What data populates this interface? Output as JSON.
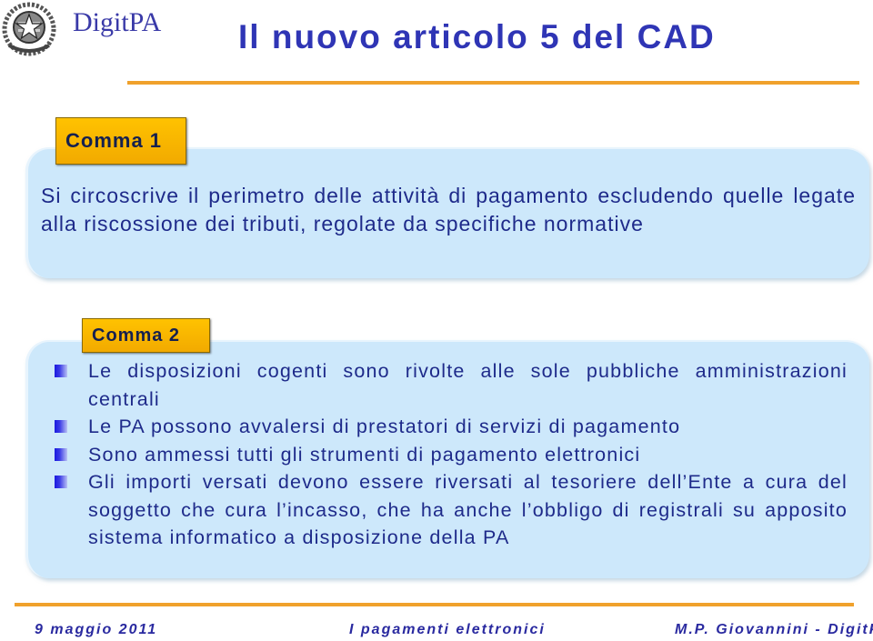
{
  "header": {
    "logo_emblem": "italian-republic-emblem",
    "logo_text": "DigitPA",
    "title": "Il nuovo articolo 5 del CAD"
  },
  "colors": {
    "title": "#2f35b5",
    "rule": "#f0a12c",
    "box_bg": "#cde8fb",
    "label_bg": "#ffc200",
    "body_text": "#1e2a8a"
  },
  "sections": [
    {
      "label": "Comma 1",
      "text": "Si circoscrive il perimetro delle attività di pagamento escludendo quelle legate alla riscossione dei tributi, regolate da specifiche normative"
    },
    {
      "label": "Comma 2",
      "bullets": [
        "Le disposizioni cogenti sono rivolte alle sole pubbliche amministrazioni centrali",
        "Le PA possono avvalersi di prestatori di servizi di pagamento",
        "Sono ammessi tutti gli strumenti di pagamento elettronici",
        "Gli importi versati devono essere riversati al tesoriere dell’Ente a cura del soggetto che cura l’incasso, che ha anche l’obbligo di registrali su apposito sistema informatico a disposizione della PA"
      ]
    }
  ],
  "footer": {
    "date": "9 maggio 2011",
    "topic": "I pagamenti elettronici",
    "author": "M.P. Giovannini - DigitPA"
  }
}
